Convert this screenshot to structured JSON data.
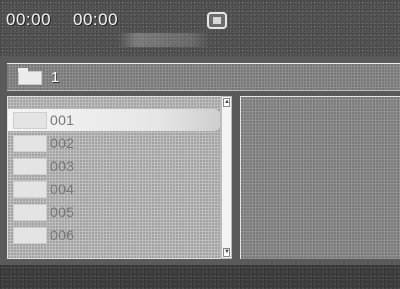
{
  "header": {
    "time_elapsed": "00:00",
    "time_total": "00:00",
    "disc_icon": "disc-stop-icon"
  },
  "path_bar": {
    "folder_icon": "folder-icon",
    "current_folder": "1"
  },
  "file_list": {
    "items": [
      {
        "label": "001",
        "selected": true
      },
      {
        "label": "002",
        "selected": false
      },
      {
        "label": "003",
        "selected": false
      },
      {
        "label": "004",
        "selected": false
      },
      {
        "label": "005",
        "selected": false
      },
      {
        "label": "006",
        "selected": false
      }
    ]
  },
  "colors": {
    "selection": "#f0f0f0",
    "text_light": "#f2f2f2",
    "text_dim": "#777777"
  }
}
